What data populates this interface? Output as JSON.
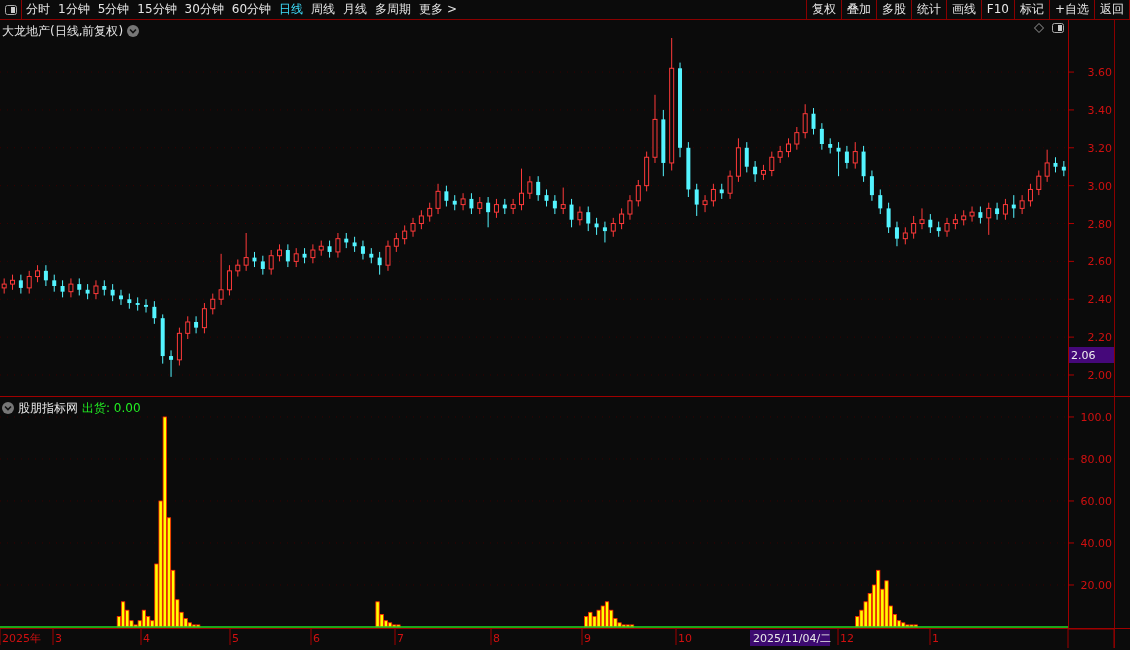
{
  "toolbar": {
    "periods": [
      {
        "label": "分时",
        "selected": false
      },
      {
        "label": "1分钟",
        "selected": false
      },
      {
        "label": "5分钟",
        "selected": false
      },
      {
        "label": "15分钟",
        "selected": false
      },
      {
        "label": "30分钟",
        "selected": false
      },
      {
        "label": "60分钟",
        "selected": false
      },
      {
        "label": "日线",
        "selected": true
      },
      {
        "label": "周线",
        "selected": false
      },
      {
        "label": "月线",
        "selected": false
      },
      {
        "label": "多周期",
        "selected": false
      },
      {
        "label": "更多 >",
        "selected": false
      }
    ],
    "actions": [
      "复权",
      "叠加",
      "多股",
      "统计",
      "画线",
      "F10",
      "标记",
      "+自选",
      "返回"
    ]
  },
  "price_panel": {
    "title": "大龙地产(日线,前复权)",
    "current_price": "2.06",
    "chart_data": {
      "type": "candlestick",
      "ylim": [
        1.889,
        3.875
      ],
      "grid": true,
      "yticks": [
        {
          "value": 3.6,
          "label": "3.60"
        },
        {
          "value": 3.4,
          "label": "3.40"
        },
        {
          "value": 3.2,
          "label": "3.20"
        },
        {
          "value": 3.0,
          "label": "3.00"
        },
        {
          "value": 2.8,
          "label": "2.80"
        },
        {
          "value": 2.6,
          "label": "2.60"
        },
        {
          "value": 2.4,
          "label": "2.40"
        },
        {
          "value": 2.2,
          "label": "2.20"
        },
        {
          "value": 2.0,
          "label": "2.00"
        }
      ],
      "ohlc": [
        [
          2.46,
          2.51,
          2.43,
          2.48
        ],
        [
          2.48,
          2.53,
          2.45,
          2.5
        ],
        [
          2.5,
          2.53,
          2.43,
          2.46
        ],
        [
          2.46,
          2.55,
          2.43,
          2.52
        ],
        [
          2.52,
          2.58,
          2.49,
          2.55
        ],
        [
          2.55,
          2.58,
          2.47,
          2.5
        ],
        [
          2.5,
          2.53,
          2.44,
          2.47
        ],
        [
          2.47,
          2.5,
          2.41,
          2.44
        ],
        [
          2.44,
          2.51,
          2.41,
          2.48
        ],
        [
          2.48,
          2.51,
          2.42,
          2.45
        ],
        [
          2.45,
          2.48,
          2.4,
          2.43
        ],
        [
          2.43,
          2.5,
          2.4,
          2.47
        ],
        [
          2.47,
          2.5,
          2.42,
          2.45
        ],
        [
          2.45,
          2.48,
          2.39,
          2.42
        ],
        [
          2.42,
          2.45,
          2.37,
          2.4
        ],
        [
          2.4,
          2.43,
          2.35,
          2.38
        ],
        [
          2.38,
          2.41,
          2.34,
          2.37
        ],
        [
          2.37,
          2.4,
          2.33,
          2.36
        ],
        [
          2.36,
          2.39,
          2.27,
          2.3
        ],
        [
          2.3,
          2.32,
          2.06,
          2.1
        ],
        [
          2.1,
          2.13,
          1.99,
          2.08
        ],
        [
          2.08,
          2.25,
          2.05,
          2.22
        ],
        [
          2.22,
          2.31,
          2.19,
          2.28
        ],
        [
          2.28,
          2.31,
          2.22,
          2.25
        ],
        [
          2.25,
          2.38,
          2.22,
          2.35
        ],
        [
          2.35,
          2.43,
          2.32,
          2.4
        ],
        [
          2.4,
          2.64,
          2.37,
          2.45
        ],
        [
          2.45,
          2.58,
          2.42,
          2.55
        ],
        [
          2.55,
          2.61,
          2.52,
          2.58
        ],
        [
          2.58,
          2.75,
          2.55,
          2.62
        ],
        [
          2.62,
          2.65,
          2.57,
          2.6
        ],
        [
          2.6,
          2.63,
          2.53,
          2.56
        ],
        [
          2.56,
          2.66,
          2.53,
          2.63
        ],
        [
          2.63,
          2.69,
          2.6,
          2.66
        ],
        [
          2.66,
          2.69,
          2.57,
          2.6
        ],
        [
          2.6,
          2.67,
          2.57,
          2.64
        ],
        [
          2.64,
          2.67,
          2.59,
          2.62
        ],
        [
          2.62,
          2.69,
          2.59,
          2.66
        ],
        [
          2.66,
          2.71,
          2.63,
          2.68
        ],
        [
          2.68,
          2.71,
          2.62,
          2.65
        ],
        [
          2.65,
          2.75,
          2.62,
          2.72
        ],
        [
          2.72,
          2.75,
          2.67,
          2.7
        ],
        [
          2.7,
          2.73,
          2.65,
          2.68
        ],
        [
          2.68,
          2.71,
          2.61,
          2.64
        ],
        [
          2.64,
          2.67,
          2.59,
          2.62
        ],
        [
          2.62,
          2.65,
          2.53,
          2.58
        ],
        [
          2.58,
          2.71,
          2.55,
          2.68
        ],
        [
          2.68,
          2.75,
          2.65,
          2.72
        ],
        [
          2.72,
          2.79,
          2.69,
          2.76
        ],
        [
          2.76,
          2.83,
          2.73,
          2.8
        ],
        [
          2.8,
          2.87,
          2.77,
          2.84
        ],
        [
          2.84,
          2.91,
          2.81,
          2.88
        ],
        [
          2.88,
          3.01,
          2.85,
          2.97
        ],
        [
          2.97,
          3.0,
          2.89,
          2.92
        ],
        [
          2.92,
          2.95,
          2.87,
          2.9
        ],
        [
          2.9,
          2.96,
          2.87,
          2.93
        ],
        [
          2.93,
          2.96,
          2.85,
          2.88
        ],
        [
          2.88,
          2.94,
          2.85,
          2.91
        ],
        [
          2.91,
          2.94,
          2.78,
          2.86
        ],
        [
          2.86,
          2.93,
          2.83,
          2.9
        ],
        [
          2.9,
          2.93,
          2.85,
          2.88
        ],
        [
          2.88,
          2.93,
          2.85,
          2.9
        ],
        [
          2.9,
          3.09,
          2.87,
          2.96
        ],
        [
          2.96,
          3.05,
          2.93,
          3.02
        ],
        [
          3.02,
          3.05,
          2.92,
          2.95
        ],
        [
          2.95,
          2.98,
          2.89,
          2.92
        ],
        [
          2.92,
          2.95,
          2.85,
          2.88
        ],
        [
          2.88,
          2.99,
          2.85,
          2.9
        ],
        [
          2.9,
          2.93,
          2.78,
          2.82
        ],
        [
          2.82,
          2.89,
          2.79,
          2.86
        ],
        [
          2.86,
          2.89,
          2.76,
          2.8
        ],
        [
          2.8,
          2.83,
          2.74,
          2.78
        ],
        [
          2.78,
          2.81,
          2.7,
          2.76
        ],
        [
          2.76,
          2.83,
          2.73,
          2.8
        ],
        [
          2.8,
          2.88,
          2.77,
          2.85
        ],
        [
          2.85,
          2.95,
          2.82,
          2.92
        ],
        [
          2.92,
          3.03,
          2.89,
          3.0
        ],
        [
          3.0,
          3.18,
          2.97,
          3.15
        ],
        [
          3.15,
          3.48,
          3.12,
          3.35
        ],
        [
          3.35,
          3.4,
          3.05,
          3.12
        ],
        [
          3.12,
          3.78,
          3.08,
          3.62
        ],
        [
          3.62,
          3.65,
          3.15,
          3.2
        ],
        [
          3.2,
          3.23,
          2.94,
          2.98
        ],
        [
          2.98,
          3.01,
          2.84,
          2.9
        ],
        [
          2.9,
          2.95,
          2.86,
          2.92
        ],
        [
          2.92,
          3.01,
          2.89,
          2.98
        ],
        [
          2.98,
          3.01,
          2.93,
          2.96
        ],
        [
          2.96,
          3.08,
          2.93,
          3.05
        ],
        [
          3.05,
          3.25,
          3.02,
          3.2
        ],
        [
          3.2,
          3.23,
          3.07,
          3.1
        ],
        [
          3.1,
          3.13,
          3.02,
          3.06
        ],
        [
          3.06,
          3.11,
          3.03,
          3.08
        ],
        [
          3.08,
          3.18,
          3.05,
          3.15
        ],
        [
          3.15,
          3.21,
          3.12,
          3.18
        ],
        [
          3.18,
          3.25,
          3.15,
          3.22
        ],
        [
          3.22,
          3.31,
          3.19,
          3.28
        ],
        [
          3.28,
          3.43,
          3.25,
          3.38
        ],
        [
          3.38,
          3.41,
          3.27,
          3.3
        ],
        [
          3.3,
          3.33,
          3.19,
          3.22
        ],
        [
          3.22,
          3.25,
          3.17,
          3.2
        ],
        [
          3.2,
          3.23,
          3.05,
          3.18
        ],
        [
          3.18,
          3.21,
          3.09,
          3.12
        ],
        [
          3.12,
          3.23,
          3.09,
          3.18
        ],
        [
          3.18,
          3.21,
          3.02,
          3.05
        ],
        [
          3.05,
          3.08,
          2.92,
          2.95
        ],
        [
          2.95,
          2.98,
          2.85,
          2.88
        ],
        [
          2.88,
          2.91,
          2.75,
          2.78
        ],
        [
          2.78,
          2.81,
          2.68,
          2.72
        ],
        [
          2.72,
          2.78,
          2.69,
          2.75
        ],
        [
          2.75,
          2.84,
          2.72,
          2.8
        ],
        [
          2.8,
          2.88,
          2.77,
          2.82
        ],
        [
          2.82,
          2.85,
          2.75,
          2.78
        ],
        [
          2.78,
          2.81,
          2.73,
          2.76
        ],
        [
          2.76,
          2.83,
          2.73,
          2.8
        ],
        [
          2.8,
          2.85,
          2.77,
          2.82
        ],
        [
          2.82,
          2.87,
          2.79,
          2.84
        ],
        [
          2.84,
          2.89,
          2.81,
          2.86
        ],
        [
          2.86,
          2.89,
          2.8,
          2.83
        ],
        [
          2.83,
          2.91,
          2.74,
          2.88
        ],
        [
          2.88,
          2.91,
          2.82,
          2.85
        ],
        [
          2.85,
          2.93,
          2.82,
          2.9
        ],
        [
          2.9,
          2.95,
          2.83,
          2.88
        ],
        [
          2.88,
          2.95,
          2.85,
          2.92
        ],
        [
          2.92,
          3.01,
          2.89,
          2.98
        ],
        [
          2.98,
          3.08,
          2.95,
          3.05
        ],
        [
          3.05,
          3.19,
          3.02,
          3.12
        ],
        [
          3.12,
          3.15,
          3.07,
          3.1
        ],
        [
          3.1,
          3.13,
          3.05,
          3.08
        ]
      ]
    }
  },
  "indicator": {
    "name": "股朋指标网",
    "readout": ": 0.00",
    "chart_data": {
      "type": "bar",
      "ylim": [
        0,
        109.5
      ],
      "grid": true,
      "yticks": [
        {
          "value": 20,
          "label": "20.00"
        },
        {
          "value": 40,
          "label": "40.00"
        },
        {
          "value": 60,
          "label": "60.00"
        },
        {
          "value": 80,
          "label": "80.00"
        },
        {
          "value": 100,
          "label": "100.0"
        }
      ],
      "series": [
        {
          "name": "出货",
          "color": "#ffff00",
          "values": [
            0,
            0,
            0,
            0,
            0,
            0,
            0,
            0,
            0,
            0,
            0,
            0,
            0,
            0,
            0,
            0,
            0,
            0,
            0,
            0,
            0,
            0,
            0,
            0,
            0,
            0,
            0,
            0,
            5,
            12,
            8,
            3,
            1,
            3,
            8,
            5,
            3,
            30,
            60,
            100,
            52,
            27,
            13,
            7,
            4,
            2,
            1,
            1,
            0,
            0,
            0,
            0,
            0,
            0,
            0,
            0,
            0,
            0,
            0,
            0,
            0,
            0,
            0,
            0,
            0,
            0,
            0,
            0,
            0,
            0,
            0,
            0,
            0,
            0,
            0,
            0,
            0,
            0,
            0,
            0,
            0,
            0,
            0,
            0,
            0,
            0,
            0,
            0,
            0,
            0,
            12,
            6,
            3,
            2,
            1,
            1,
            0,
            0,
            0,
            0,
            0,
            0,
            0,
            0,
            0,
            0,
            0,
            0,
            0,
            0,
            0,
            0,
            0,
            0,
            0,
            0,
            0,
            0,
            0,
            0,
            0,
            0,
            0,
            0,
            0,
            0,
            0,
            0,
            0,
            0,
            0,
            0,
            0,
            0,
            0,
            0,
            0,
            0,
            0,
            0,
            5,
            7,
            5,
            8,
            10,
            12,
            8,
            4,
            2,
            1,
            1,
            1,
            0,
            0,
            0,
            0,
            0,
            0,
            0,
            0,
            0,
            0,
            0,
            0,
            0,
            0,
            0,
            0,
            0,
            0,
            0,
            0,
            0,
            0,
            0,
            0,
            0,
            0,
            0,
            0,
            0,
            0,
            0,
            0,
            0,
            0,
            0,
            0,
            0,
            0,
            0,
            0,
            0,
            0,
            0,
            0,
            0,
            0,
            0,
            0,
            0,
            0,
            0,
            0,
            0,
            5,
            8,
            12,
            16,
            20,
            27,
            18,
            22,
            10,
            6,
            3,
            2,
            1,
            1,
            1,
            0,
            0,
            0,
            0,
            0,
            0,
            0,
            0,
            0,
            0,
            0,
            0,
            0,
            0,
            0,
            0,
            0,
            0,
            0,
            0,
            0,
            0,
            0,
            0,
            0,
            0,
            0,
            0,
            0,
            0,
            0,
            0,
            0,
            0,
            0,
            0
          ]
        }
      ]
    }
  },
  "date_axis": [
    {
      "text": "2025年",
      "kind": "label"
    },
    {
      "text": "3",
      "kind": "label"
    },
    {
      "text": "4",
      "kind": "label"
    },
    {
      "text": "5",
      "kind": "label"
    },
    {
      "text": "6",
      "kind": "label"
    },
    {
      "text": "7",
      "kind": "label"
    },
    {
      "text": "8",
      "kind": "label"
    },
    {
      "text": "9",
      "kind": "label"
    },
    {
      "text": "10",
      "kind": "label"
    },
    {
      "text": "2025/11/04/二",
      "kind": "cursor"
    },
    {
      "text": "12",
      "kind": "label"
    },
    {
      "text": "1",
      "kind": "label"
    }
  ]
}
